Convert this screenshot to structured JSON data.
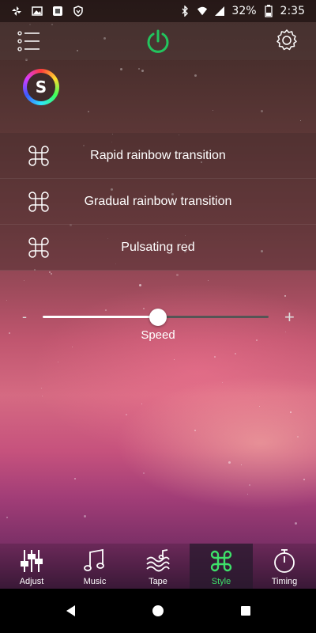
{
  "status_bar": {
    "battery": "32%",
    "time": "2:35",
    "icons": [
      "pinwheel-icon",
      "image-icon",
      "store-icon",
      "shield-icon",
      "bluetooth-icon",
      "wifi-icon",
      "signal-icon",
      "battery-icon"
    ]
  },
  "header": {
    "icons": [
      "menu-icon",
      "power-icon",
      "settings-icon"
    ],
    "power_color": "#22c55e"
  },
  "logo": {
    "letter": "S"
  },
  "modes": [
    {
      "label": "Rapid rainbow transition",
      "icon": "command-icon"
    },
    {
      "label": "Gradual rainbow transition",
      "icon": "command-icon"
    },
    {
      "label": "Pulsating red",
      "icon": "command-icon"
    }
  ],
  "speed_slider": {
    "label": "Speed",
    "minus": "-",
    "plus": "+",
    "value_fraction": 0.51
  },
  "tabs": [
    {
      "label": "Adjust",
      "icon": "sliders-icon",
      "active": false
    },
    {
      "label": "Music",
      "icon": "music-note-icon",
      "active": false
    },
    {
      "label": "Tape",
      "icon": "tape-wave-icon",
      "active": false
    },
    {
      "label": "Style",
      "icon": "command-icon",
      "active": true
    },
    {
      "label": "Timing",
      "icon": "stopwatch-icon",
      "active": false
    }
  ],
  "accent_color": "#3ee06a",
  "nav_bar": {
    "icons": [
      "back-icon",
      "home-icon",
      "recents-icon"
    ]
  }
}
